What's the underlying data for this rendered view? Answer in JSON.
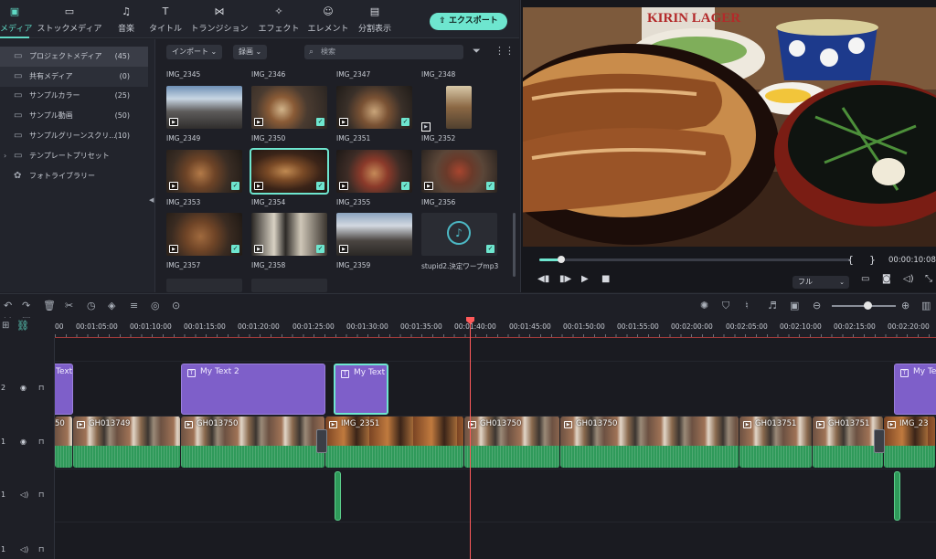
{
  "tabs": [
    {
      "label": "メディア",
      "icon": "media-icon"
    },
    {
      "label": "ストックメディア",
      "icon": "stock-media-icon"
    },
    {
      "label": "音楽",
      "icon": "music-icon"
    },
    {
      "label": "タイトル",
      "icon": "title-icon"
    },
    {
      "label": "トランジション",
      "icon": "transition-icon"
    },
    {
      "label": "エフェクト",
      "icon": "effect-icon"
    },
    {
      "label": "エレメント",
      "icon": "element-icon"
    },
    {
      "label": "分割表示",
      "icon": "split-screen-icon"
    }
  ],
  "export_label": "エクスポート",
  "sidebar": {
    "items": [
      {
        "label": "プロジェクトメディア",
        "count": "(45)"
      },
      {
        "label": "共有メディア",
        "count": "(0)"
      },
      {
        "label": "サンプルカラー",
        "count": "(25)"
      },
      {
        "label": "サンプル動画",
        "count": "(50)"
      },
      {
        "label": "サンプルグリーンスクリ...",
        "count": "(10)"
      },
      {
        "label": "テンプレートプリセット",
        "count": ""
      },
      {
        "label": "フォトライブラリー",
        "count": ""
      }
    ]
  },
  "media": {
    "import_label": "インポート",
    "record_label": "録画",
    "search_placeholder": "検索",
    "items": [
      {
        "name": "IMG_2345"
      },
      {
        "name": "IMG_2346"
      },
      {
        "name": "IMG_2347"
      },
      {
        "name": "IMG_2348"
      },
      {
        "name": "IMG_2349"
      },
      {
        "name": "IMG_2350"
      },
      {
        "name": "IMG_2351"
      },
      {
        "name": "IMG_2352"
      },
      {
        "name": "IMG_2353"
      },
      {
        "name": "IMG_2354"
      },
      {
        "name": "IMG_2355"
      },
      {
        "name": "IMG_2356"
      },
      {
        "name": "IMG_2357"
      },
      {
        "name": "IMG_2358"
      },
      {
        "name": "IMG_2359"
      },
      {
        "name": "stupid2.決定ワープmp3"
      }
    ]
  },
  "preview": {
    "timecode": "00:00:10:08",
    "quality": "フル",
    "progress": 0.07
  },
  "ruler": {
    "labels": [
      "00",
      "00:01:05:00",
      "00:01:10:00",
      "00:01:15:00",
      "00:01:20:00",
      "00:01:25:00",
      "00:01:30:00",
      "00:01:35:00",
      "00:01:40:00",
      "00:01:45:00",
      "00:01:50:00",
      "00:01:55:00",
      "00:02:00:00",
      "00:02:05:00",
      "00:02:10:00",
      "00:02:15:00",
      "00:02:20:00"
    ]
  },
  "tracks": {
    "headers": [
      {
        "num": "2"
      },
      {
        "num": "1"
      },
      {
        "num": "1"
      },
      {
        "num": "1"
      }
    ],
    "titles": [
      {
        "label": "Text"
      },
      {
        "label": "My Text 2"
      },
      {
        "label": "My Text"
      },
      {
        "label": "My Te"
      }
    ],
    "videos": [
      {
        "label": "50"
      },
      {
        "label": "GH013749"
      },
      {
        "label": "GH013750"
      },
      {
        "label": "IMG_2351"
      },
      {
        "label": "GH013750"
      },
      {
        "label": "GH013750"
      },
      {
        "label": "GH013751"
      },
      {
        "label": "GH013751"
      },
      {
        "label": "IMG_23"
      }
    ]
  },
  "colors": {
    "accent": "#6ee6cf",
    "title_clip": "#7e5fc9",
    "audio": "#2f9a5a",
    "playhead": "#ff5a5a"
  }
}
